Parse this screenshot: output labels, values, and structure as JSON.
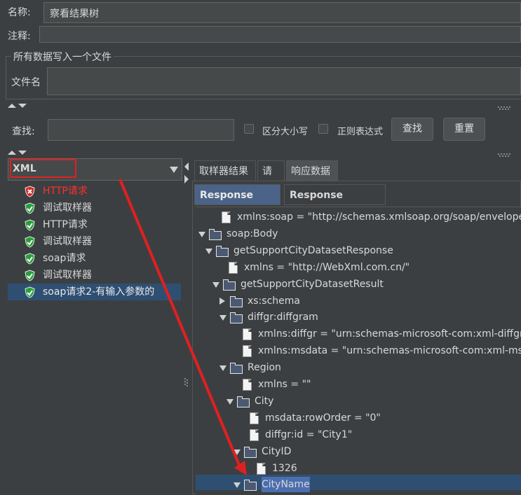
{
  "form": {
    "name_label": "名称:",
    "name_value": "察看结果树",
    "comment_label": "注释:",
    "comment_value": "",
    "group_title": "所有数据写入一个文件",
    "filename_label": "文件名",
    "filename_value": ""
  },
  "search": {
    "label": "查找:",
    "value": "",
    "case_label": "区分大小写",
    "regex_label": "正则表达式",
    "find_button": "查找",
    "reset_button": "重置"
  },
  "renderer": {
    "selected": "XML"
  },
  "sampler_tree": [
    {
      "label": "HTTP请求",
      "status": "fail"
    },
    {
      "label": "调试取样器",
      "status": "ok"
    },
    {
      "label": "HTTP请求",
      "status": "ok"
    },
    {
      "label": "调试取样器",
      "status": "ok"
    },
    {
      "label": "soap请求",
      "status": "ok"
    },
    {
      "label": "调试取样器",
      "status": "ok"
    },
    {
      "label": "soap请求2-有输入参数的",
      "status": "ok",
      "selected": true
    }
  ],
  "tabs": [
    "取样器结果",
    "请求",
    "响应数据"
  ],
  "subtabs": [
    "Response Body",
    "Response headers"
  ],
  "xml_tree": [
    {
      "text": "xmlns:soap = \"http://schemas.xmlsoap.org/soap/envelope/\"",
      "kind": "attr"
    },
    {
      "text": "soap:Body",
      "kind": "folder",
      "expanded": true
    },
    {
      "text": "getSupportCityDatasetResponse",
      "kind": "folder",
      "expanded": true
    },
    {
      "text": "xmlns = \"http://WebXml.com.cn/\"",
      "kind": "attr"
    },
    {
      "text": "getSupportCityDatasetResult",
      "kind": "folder",
      "expanded": true
    },
    {
      "text": "xs:schema",
      "kind": "folder",
      "expanded": false
    },
    {
      "text": "diffgr:diffgram",
      "kind": "folder",
      "expanded": true
    },
    {
      "text": "xmlns:diffgr = \"urn:schemas-microsoft-com:xml-diffgram-v",
      "kind": "attr"
    },
    {
      "text": "xmlns:msdata = \"urn:schemas-microsoft-com:xml-msdata",
      "kind": "attr"
    },
    {
      "text": "Region",
      "kind": "folder",
      "expanded": true
    },
    {
      "text": "xmlns = \"\"",
      "kind": "attr"
    },
    {
      "text": "City",
      "kind": "folder",
      "expanded": true
    },
    {
      "text": "msdata:rowOrder = \"0\"",
      "kind": "attr"
    },
    {
      "text": "diffgr:id = \"City1\"",
      "kind": "attr"
    },
    {
      "text": "CityID",
      "kind": "folder",
      "expanded": true
    },
    {
      "text": "1326",
      "kind": "attr"
    },
    {
      "text": "CityName",
      "kind": "folder",
      "expanded": true,
      "selected": true
    }
  ],
  "colors": {
    "background": "#3c3f41",
    "field": "#45494a",
    "selection": "#2f4f72",
    "fail_text": "#ff3030",
    "annotation_red": "#e02020"
  }
}
